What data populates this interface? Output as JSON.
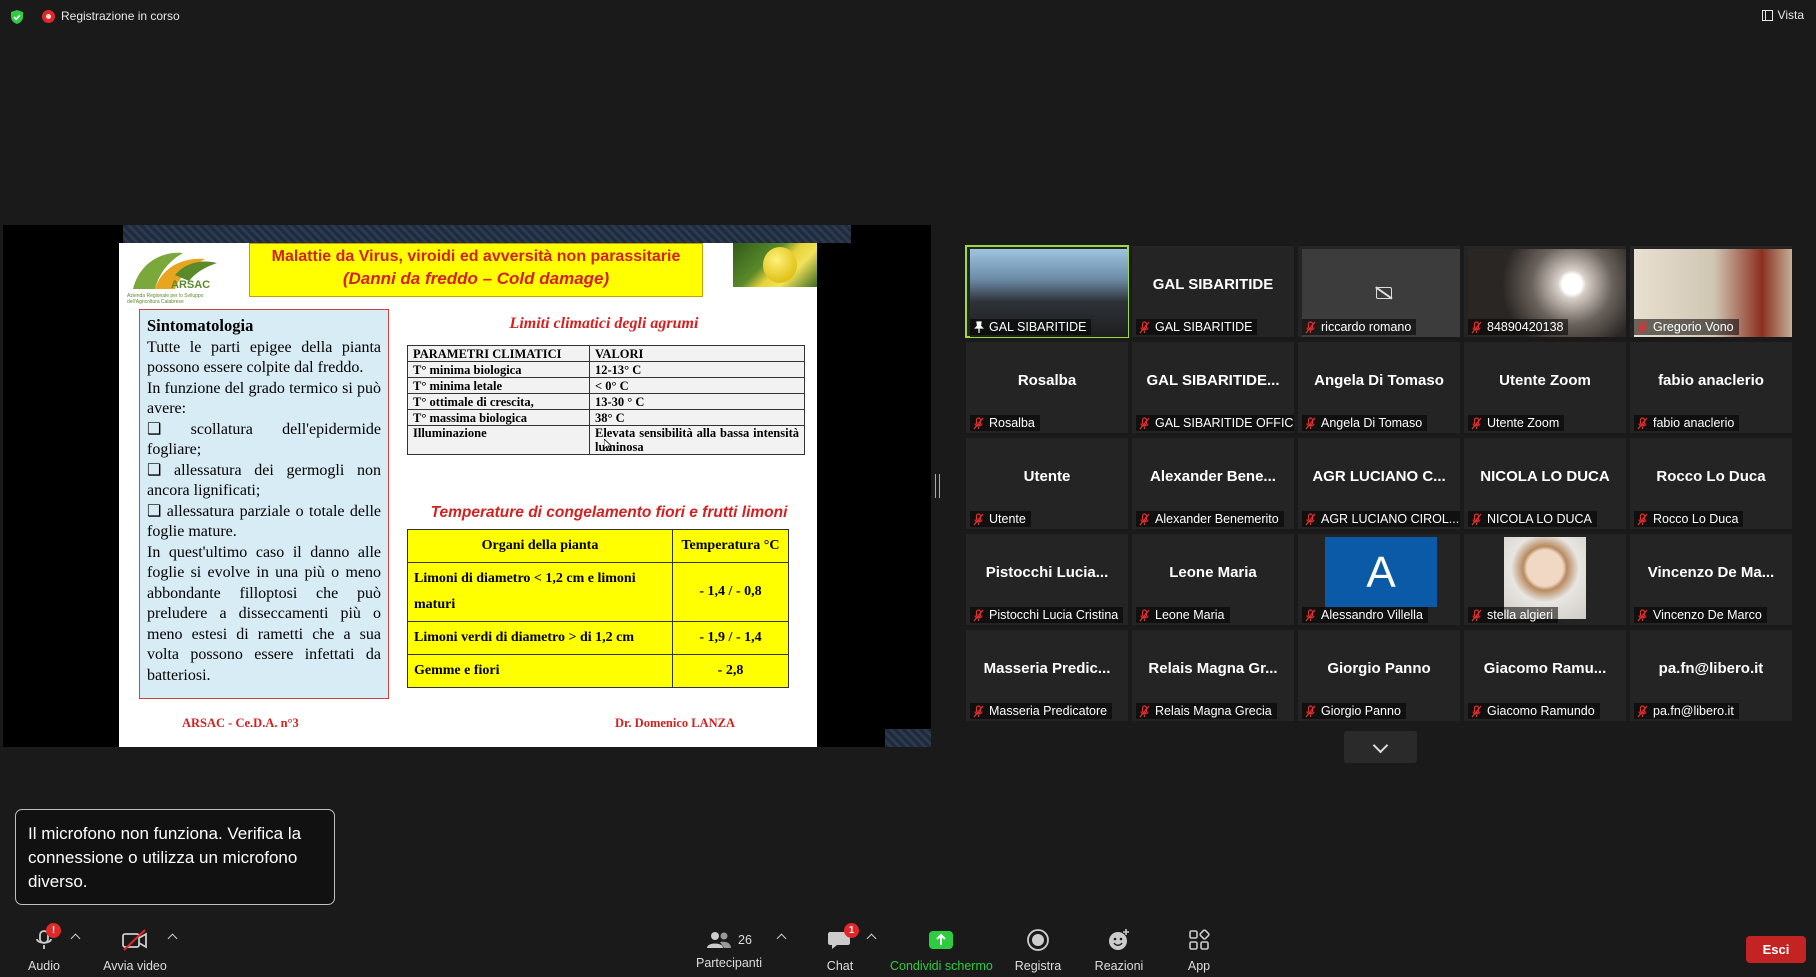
{
  "topbar": {
    "recording_label": "Registrazione in corso",
    "view_label": "Vista"
  },
  "slide": {
    "logo_text": "ARSAC",
    "logo_sub": "Azienda Regionale per lo Sviluppo dell'Agricoltura Calabrese",
    "title_line1": "Malattie da Virus, viroidi ed avversità non parassitarie",
    "title_line2": "(Danni da freddo – Cold damage)",
    "sintomatologia_title": "Sintomatologia",
    "sintomatologia_lines": [
      "Tutte le parti epigee della pianta possono essere colpite dal freddo.",
      "In funzione del grado termico si può avere:",
      "❑ scollatura dell'epidermide fogliare;",
      "❑ allessatura dei germogli non ancora lignificati;",
      "❑ allessatura parziale o totale delle foglie mature.",
      "In quest'ultimo caso il danno alle foglie si evolve in una più o meno abbondante filloptosi che può preludere a disseccamenti più o meno estesi di rametti che a sua volta possono essere infettati da batteriosi."
    ],
    "limiti_title": "Limiti climatici degli agrumi",
    "param_table": {
      "header": [
        "PARAMETRI CLIMATICI",
        "VALORI"
      ],
      "rows": [
        [
          "T° minima biologica",
          "12-13° C"
        ],
        [
          "T° minima letale",
          "< 0° C"
        ],
        [
          "T° ottimale di crescita,",
          "13-30 ° C"
        ],
        [
          "T° massima biologica",
          "38° C"
        ],
        [
          "Illuminazione",
          "Elevata sensibilità alla bassa intensità luminosa"
        ]
      ]
    },
    "temp_title": "Temperature di congelamento fiori e frutti limoni",
    "temp_table": {
      "header": [
        "Organi della pianta",
        "Temperatura °C"
      ],
      "rows": [
        [
          "Limoni di diametro < 1,2 cm e limoni maturi",
          "- 1,4 / - 0,8"
        ],
        [
          "Limoni verdi di diametro > di 1,2 cm",
          "- 1,9 / - 1,4"
        ],
        [
          "Gemme e fiori",
          "- 2,8"
        ]
      ]
    },
    "footer_left": "ARSAC - Ce.D.A. n°3",
    "footer_right": "Dr. Domenico LANZA"
  },
  "participants": [
    {
      "big": "",
      "label": "GAL SIBARITIDE",
      "kind": "video-room",
      "active": true
    },
    {
      "big": "GAL SIBARITIDE",
      "label": "GAL SIBARITIDE",
      "kind": "name"
    },
    {
      "big": "",
      "label": "riccardo romano",
      "kind": "cam-off"
    },
    {
      "big": "",
      "label": "84890420138",
      "kind": "video-dark"
    },
    {
      "big": "",
      "label": "Gregorio Vono",
      "kind": "video-room3"
    },
    {
      "big": "Rosalba",
      "label": "Rosalba",
      "kind": "name"
    },
    {
      "big": "GAL SIBARITIDE...",
      "label": "GAL SIBARITIDE OFFICE",
      "kind": "name"
    },
    {
      "big": "Angela Di Tomaso",
      "label": "Angela Di Tomaso",
      "kind": "name"
    },
    {
      "big": "Utente Zoom",
      "label": "Utente Zoom",
      "kind": "name"
    },
    {
      "big": "fabio anaclerio",
      "label": "fabio anaclerio",
      "kind": "name"
    },
    {
      "big": "Utente",
      "label": "Utente",
      "kind": "name"
    },
    {
      "big": "Alexander Bene...",
      "label": "Alexander Benemerito",
      "kind": "name"
    },
    {
      "big": "AGR LUCIANO C...",
      "label": "AGR LUCIANO CIROL...",
      "kind": "name"
    },
    {
      "big": "NICOLA LO DUCA",
      "label": "NICOLA LO DUCA",
      "kind": "name"
    },
    {
      "big": "Rocco Lo Duca",
      "label": "Rocco Lo Duca",
      "kind": "name"
    },
    {
      "big": "Pistocchi Lucia...",
      "label": "Pistocchi Lucia Cristina",
      "kind": "name"
    },
    {
      "big": "Leone Maria",
      "label": "Leone Maria",
      "kind": "name"
    },
    {
      "big": "A",
      "label": "Alessandro Villella",
      "kind": "avatar-letter"
    },
    {
      "big": "",
      "label": "stella algieri",
      "kind": "avatar-photo"
    },
    {
      "big": "Vincenzo De Ma...",
      "label": "Vincenzo De Marco",
      "kind": "name"
    },
    {
      "big": "Masseria Predic...",
      "label": "Masseria Predicatore",
      "kind": "name"
    },
    {
      "big": "Relais Magna Gr...",
      "label": "Relais Magna Grecia",
      "kind": "name"
    },
    {
      "big": "Giorgio Panno",
      "label": "Giorgio Panno",
      "kind": "name"
    },
    {
      "big": "Giacomo Ramu...",
      "label": "Giacomo Ramundo",
      "kind": "name"
    },
    {
      "big": "pa.fn@libero.it",
      "label": "pa.fn@libero.it",
      "kind": "name"
    }
  ],
  "mic_tooltip": "Il microfono non funziona. Verifica la connessione o utilizza un microfono diverso.",
  "toolbar": {
    "audio": "Audio",
    "video": "Avvia video",
    "participants": "Partecipanti",
    "participants_count": "26",
    "chat": "Chat",
    "chat_badge": "1",
    "audio_badge": "!",
    "share": "Condividi schermo",
    "record": "Registra",
    "reactions": "Reazioni",
    "apps": "App",
    "leave": "Esci"
  },
  "colors": {
    "background": "#1a1a1a",
    "active_speaker": "#9bdc3a",
    "leave": "#c42323",
    "share_green": "#2ecc40",
    "slide_title_bg": "#ffff00",
    "slide_red": "#d42020"
  }
}
